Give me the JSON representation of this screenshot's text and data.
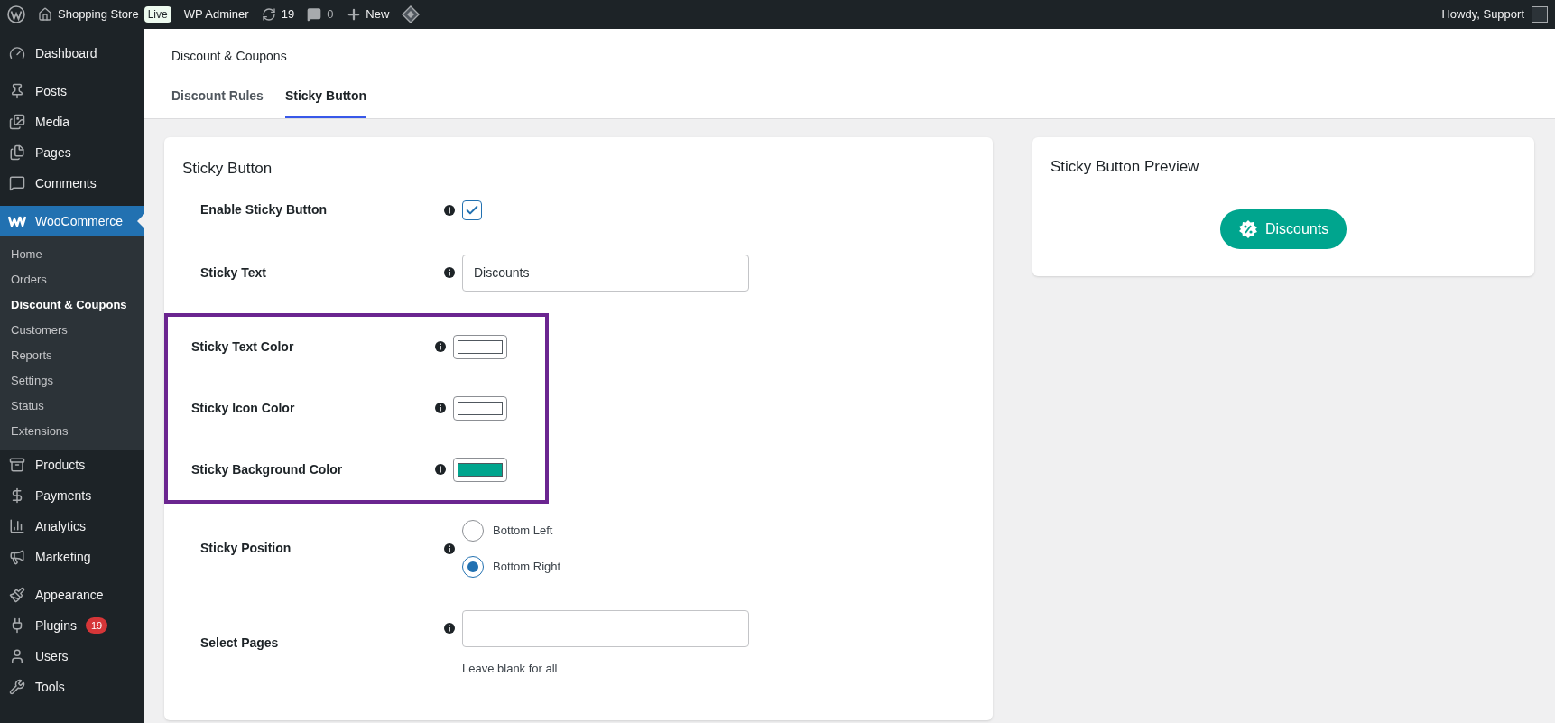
{
  "topbar": {
    "site": "Shopping Store",
    "badge": "Live",
    "plugin": "WP Adminer",
    "updates": "19",
    "comments": "0",
    "new": "New",
    "greeting": "Howdy, Support"
  },
  "sidebar": {
    "groups": [
      [
        {
          "label": "Dashboard",
          "selected": false
        }
      ],
      [
        {
          "label": "Posts",
          "selected": false
        },
        {
          "label": "Media",
          "selected": false
        },
        {
          "label": "Pages",
          "selected": false
        },
        {
          "label": "Comments",
          "selected": false
        }
      ],
      [
        {
          "label": "WooCommerce",
          "selected": true,
          "children": [
            {
              "label": "Home",
              "selected": false
            },
            {
              "label": "Orders",
              "selected": false
            },
            {
              "label": "Discount & Coupons",
              "selected": true
            },
            {
              "label": "Customers",
              "selected": false
            },
            {
              "label": "Reports",
              "selected": false
            },
            {
              "label": "Settings",
              "selected": false
            },
            {
              "label": "Status",
              "selected": false
            },
            {
              "label": "Extensions",
              "selected": false
            }
          ]
        },
        {
          "label": "Products",
          "selected": false
        },
        {
          "label": "Payments",
          "selected": false
        },
        {
          "label": "Analytics",
          "selected": false
        },
        {
          "label": "Marketing",
          "selected": false
        }
      ],
      [
        {
          "label": "Appearance",
          "selected": false
        },
        {
          "label": "Plugins",
          "selected": false,
          "count": "19"
        },
        {
          "label": "Users",
          "selected": false
        },
        {
          "label": "Tools",
          "selected": false
        }
      ]
    ]
  },
  "header": {
    "title": "Discount & Coupons",
    "tabs": [
      {
        "label": "Discount Rules",
        "selected": false
      },
      {
        "label": "Sticky Button",
        "selected": true
      }
    ]
  },
  "form": {
    "title": "Sticky Button",
    "rows": [
      {
        "kind": "checkbox",
        "label": "Enable Sticky Button",
        "checked": true
      },
      {
        "kind": "text",
        "label": "Sticky Text",
        "value": "Discounts"
      },
      {
        "kind": "highlight",
        "rows": [
          {
            "kind": "color",
            "label": "Sticky Text Color",
            "color": "#ffffff"
          },
          {
            "kind": "color",
            "label": "Sticky Icon Color",
            "color": "#ffffff"
          },
          {
            "kind": "color",
            "label": "Sticky Background Color",
            "color": "#00a58e"
          }
        ]
      },
      {
        "kind": "radio",
        "label": "Sticky Position",
        "options": [
          {
            "label": "Bottom Left",
            "selected": false
          },
          {
            "label": "Bottom Right",
            "selected": true
          }
        ]
      },
      {
        "kind": "select",
        "label": "Select Pages",
        "hint": "Leave blank for all"
      }
    ]
  },
  "preview": {
    "title": "Sticky Button Preview",
    "button": "Discounts",
    "color": "#00a58e"
  }
}
